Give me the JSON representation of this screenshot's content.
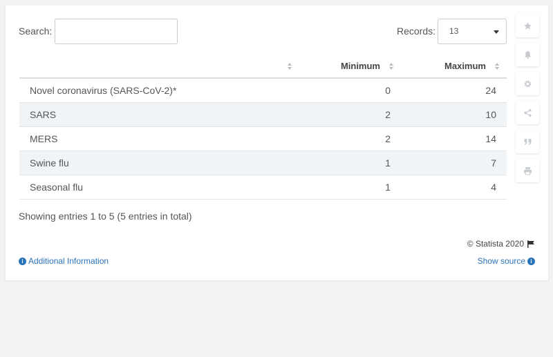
{
  "search": {
    "label": "Search:",
    "value": ""
  },
  "records": {
    "label": "Records:",
    "value": "13"
  },
  "table": {
    "headers": [
      "",
      "Minimum",
      "Maximum"
    ],
    "rows": [
      {
        "name": "Novel coronavirus (SARS-CoV-2)*",
        "min": "0",
        "max": "24"
      },
      {
        "name": "SARS",
        "min": "2",
        "max": "10"
      },
      {
        "name": "MERS",
        "min": "2",
        "max": "14"
      },
      {
        "name": "Swine flu",
        "min": "1",
        "max": "7"
      },
      {
        "name": "Seasonal flu",
        "min": "1",
        "max": "4"
      }
    ]
  },
  "footer": {
    "showing": "Showing entries 1 to 5 (5 entries in total)",
    "copyright": "© Statista 2020",
    "additional_info": "Additional Information",
    "show_source": "Show source"
  },
  "sidebar_icons": [
    "star-icon",
    "bell-icon",
    "gear-icon",
    "share-icon",
    "quote-icon",
    "print-icon"
  ],
  "colors": {
    "link": "#2a73b8",
    "stripe": "#f1f4f7",
    "icon": "#c8ccd0"
  }
}
